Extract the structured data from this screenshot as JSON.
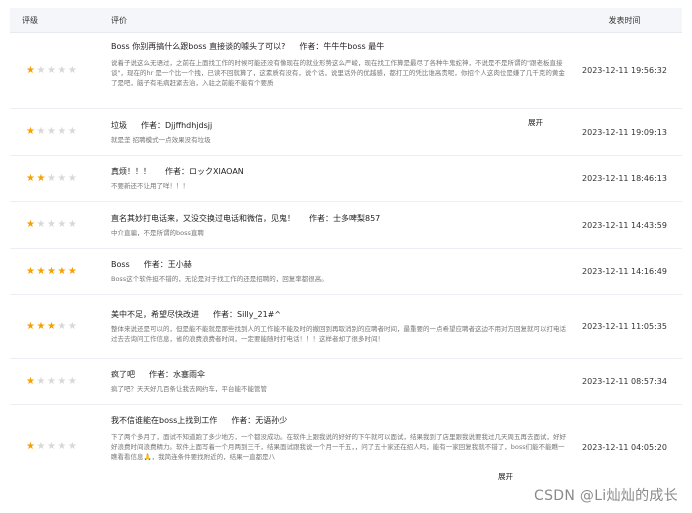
{
  "header": {
    "rating": "评级",
    "review": "评价",
    "time": "发表时间"
  },
  "rows": [
    {
      "stars": 1,
      "title": "Boss 你别再搞什么跟boss 直接谈的噱头了可以?",
      "author": "作者：牛牛牛boss 最牛",
      "content": "说着子说这么无语过，之前在上面找工作的时候可能还没有像现在的就业形势这么严峻，现在找工作算是最尽了各种牛鬼蛇神，不说是不是所谓的\"跟老板直接谈\"，现在的hr 是一个比一个拽，已读不回就算了，这素质有没有，说个话，说里话外的优越感，都打工的凭比谁高贵呢，你招个人这肉位是嫌了几千克的黄金了是吧，脑子有毛病赶紧去治，入驻之前能不能有个要质",
      "expand": "展开",
      "time": "2023-12-11 19:56:32"
    },
    {
      "stars": 1,
      "title": "垃圾",
      "author": "作者：Djjffhdhjdsjj",
      "content": "就是垄 招聘模式一点效果没有垃圾",
      "time": "2023-12-11 19:09:13"
    },
    {
      "stars": 2,
      "title": "真烦！！！",
      "author": "作者：ロックXIAOAN",
      "content": "不要新还不让用了咩！！！",
      "time": "2023-12-11 18:46:13"
    },
    {
      "stars": 1,
      "title": "直名其妙打电话来，又没交换过电话和微信，见鬼！",
      "author": "作者：士多啤梨857",
      "content": "中介直骗，不是所谓的boss直聘",
      "time": "2023-12-11 14:43:59"
    },
    {
      "stars": 5,
      "title": "Boss",
      "author": "作者：王小赫",
      "content": "Boss这个软件挺不错的，无论是对于找工作的还是招聘的，回复率都很高。",
      "time": "2023-12-11 14:16:49"
    },
    {
      "stars": 3,
      "title": "美中不足，希望尽快改进",
      "author": "作者：Silly_21#^",
      "content": "整体来说还是可以的，但是能不能就是那些找到人的工作能不能及时的撤回到再取消别的应聘者时间，最重要的一点希望应聘者这边不用对方回复就可以打电话过去去询问工作信息，省的浪费浪费者时间，一定要能随时打电话！！！这样者却了很多时间！",
      "time": "2023-12-11 11:05:35"
    },
    {
      "stars": 1,
      "title": "疯了吧",
      "author": "作者：水塞雨伞",
      "content": "疯了吧？天天好几百条让我去网约车，平台能不能管管",
      "time": "2023-12-11 08:57:34"
    },
    {
      "stars": 1,
      "title": "我不信谁能在boss上找到工作",
      "author": "作者：无语孙少",
      "content": "下了两个多月了，面试不知道跑了多少地方，一个都没成功。在软件上跟我说的好好的下午就可以面试，结果我到了店里跟我说要我过几天周五再去面试，好好好浪费时间浪费精力。软件上面写着一个月两到三千，结果面试跟我说一个月一千五，，问了五十家还在招人吗，能有一家回复我就不错了，boss们能不能瞧一瞧看看信息🙏，我简连条件要找附近的，结果一直都是八",
      "expand": "展开",
      "time": "2023-12-11 04:05:20"
    }
  ],
  "watermark": "CSDN @Li灿灿的成长",
  "colors": {
    "star_on": "#f7a100",
    "star_off": "#d8d8d8",
    "header_bg": "#f4f6f9"
  }
}
